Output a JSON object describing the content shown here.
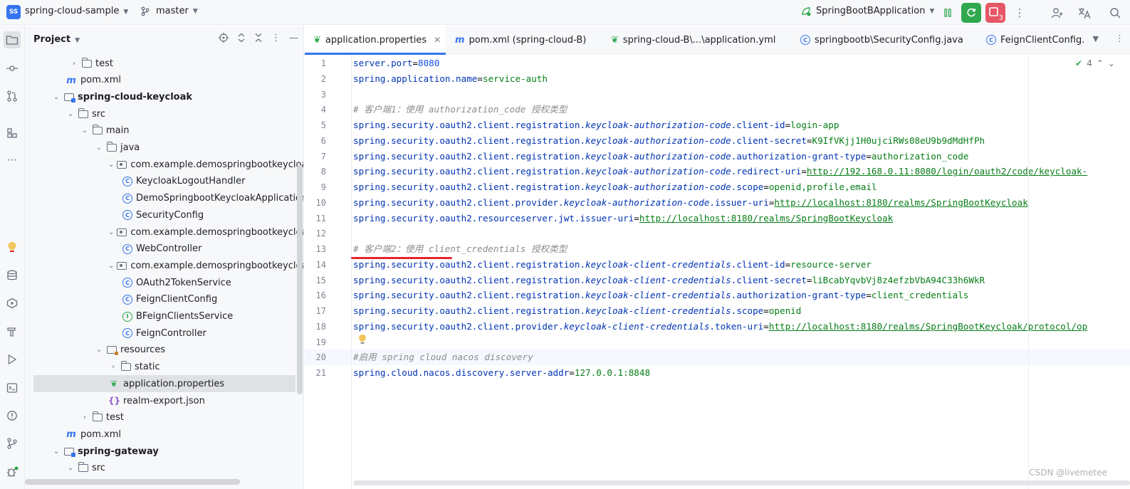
{
  "topbar": {
    "project_badge": "SS",
    "project_name": "spring-cloud-sample",
    "branch": "master",
    "run_config": "SpringBootBApplication",
    "stop_badge": "3",
    "icons": [
      "pause-icon",
      "rerun-icon",
      "stop-icon",
      "more-icon",
      "add-user-icon",
      "translate-icon",
      "search-icon"
    ]
  },
  "toolstrip": {
    "icons": [
      "folder-icon",
      "commit-icon",
      "pull-request-icon",
      "structure-icon",
      "more-icon",
      "bulb-icon",
      "database-icon",
      "services-icon",
      "build-icon",
      "run-icon",
      "terminal-icon",
      "problems-icon",
      "git-icon",
      "debug-icon"
    ]
  },
  "project_panel": {
    "title": "Project",
    "tree": [
      {
        "label": "test",
        "icon": "folder",
        "arrow": "›",
        "bold": false
      },
      {
        "label": "pom.xml",
        "icon": "maven",
        "arrow": "",
        "bold": false
      },
      {
        "label": "spring-cloud-keycloak",
        "icon": "module",
        "arrow": "⌄",
        "bold": true
      },
      {
        "label": "src",
        "icon": "folder",
        "arrow": "⌄",
        "bold": false
      },
      {
        "label": "main",
        "icon": "folder",
        "arrow": "⌄",
        "bold": false
      },
      {
        "label": "java",
        "icon": "folder",
        "arrow": "⌄",
        "bold": false
      },
      {
        "label": "com.example.demospringbootkeycloak",
        "icon": "package",
        "arrow": "⌄",
        "bold": false
      },
      {
        "label": "KeycloakLogoutHandler",
        "icon": "class",
        "arrow": "",
        "bold": false
      },
      {
        "label": "DemoSpringbootKeycloakApplication",
        "icon": "class",
        "arrow": "",
        "bold": false
      },
      {
        "label": "SecurityConfig",
        "icon": "class",
        "arrow": "",
        "bold": false
      },
      {
        "label": "com.example.demospringbootkeycloak.c",
        "icon": "package",
        "arrow": "⌄",
        "bold": false
      },
      {
        "label": "WebController",
        "icon": "class",
        "arrow": "",
        "bold": false
      },
      {
        "label": "com.example.demospringbootkeycloak.f",
        "icon": "package",
        "arrow": "⌄",
        "bold": false
      },
      {
        "label": "OAuth2TokenService",
        "icon": "class",
        "arrow": "",
        "bold": false
      },
      {
        "label": "FeignClientConfig",
        "icon": "class",
        "arrow": "",
        "bold": false
      },
      {
        "label": "BFeignClientsService",
        "icon": "interface",
        "arrow": "",
        "bold": false
      },
      {
        "label": "FeignController",
        "icon": "class",
        "arrow": "",
        "bold": false
      },
      {
        "label": "resources",
        "icon": "resources",
        "arrow": "⌄",
        "bold": false
      },
      {
        "label": "static",
        "icon": "folder",
        "arrow": "›",
        "bold": false
      },
      {
        "label": "application.properties",
        "icon": "properties",
        "arrow": "",
        "bold": false,
        "selected": true
      },
      {
        "label": "realm-export.json",
        "icon": "json",
        "arrow": "",
        "bold": false
      },
      {
        "label": "test",
        "icon": "folder",
        "arrow": "›",
        "bold": false
      },
      {
        "label": "pom.xml",
        "icon": "maven",
        "arrow": "",
        "bold": false
      },
      {
        "label": "spring-gateway",
        "icon": "module",
        "arrow": "⌄",
        "bold": true
      },
      {
        "label": "src",
        "icon": "folder",
        "arrow": "⌄",
        "bold": false
      }
    ]
  },
  "tabs": [
    {
      "label": "application.properties",
      "icon": "properties",
      "active": true
    },
    {
      "label": "pom.xml (spring-cloud-B)",
      "icon": "maven",
      "active": false
    },
    {
      "label": "spring-cloud-B\\...\\application.yml",
      "icon": "properties",
      "active": false
    },
    {
      "label": "springbootb\\SecurityConfig.java",
      "icon": "class",
      "active": false
    },
    {
      "label": "FeignClientConfig.",
      "icon": "class",
      "active": false
    }
  ],
  "editor": {
    "inspection_count": "4",
    "current_line": 20,
    "lines": [
      {
        "n": "1",
        "parts": [
          [
            "key",
            "server.port"
          ],
          [
            "eq",
            "="
          ],
          [
            "num",
            "8080"
          ]
        ]
      },
      {
        "n": "2",
        "parts": [
          [
            "key",
            "spring.application.name"
          ],
          [
            "eq",
            "="
          ],
          [
            "val",
            "service-auth"
          ]
        ]
      },
      {
        "n": "3",
        "parts": []
      },
      {
        "n": "4",
        "parts": [
          [
            "com",
            "# 客户端1：使用 authorization_code 授权类型"
          ]
        ]
      },
      {
        "n": "5",
        "parts": [
          [
            "key",
            "spring.security.oauth2.client.registration."
          ],
          [
            "it",
            "keycloak-authorization-code"
          ],
          [
            "key",
            ".client-id"
          ],
          [
            "eq",
            "="
          ],
          [
            "val",
            "login-app"
          ]
        ]
      },
      {
        "n": "6",
        "parts": [
          [
            "key",
            "spring.security.oauth2.client.registration."
          ],
          [
            "it",
            "keycloak-authorization-code"
          ],
          [
            "key",
            ".client-secret"
          ],
          [
            "eq",
            "="
          ],
          [
            "val",
            "K9IfVKjj1H0ujciRWs08eU9b9dMdHfPh"
          ]
        ]
      },
      {
        "n": "7",
        "parts": [
          [
            "key",
            "spring.security.oauth2.client.registration."
          ],
          [
            "it",
            "keycloak-authorization-code"
          ],
          [
            "key",
            ".authorization-grant-type"
          ],
          [
            "eq",
            "="
          ],
          [
            "val",
            "authorization_code"
          ]
        ]
      },
      {
        "n": "8",
        "parts": [
          [
            "key",
            "spring.security.oauth2.client.registration."
          ],
          [
            "it",
            "keycloak-authorization-code"
          ],
          [
            "key",
            ".redirect-uri"
          ],
          [
            "eq",
            "="
          ],
          [
            "url",
            "http://192.168.0.11:8080/login/oauth2/code/keycloak-"
          ]
        ]
      },
      {
        "n": "9",
        "parts": [
          [
            "key",
            "spring.security.oauth2.client.registration."
          ],
          [
            "it",
            "keycloak-authorization-code"
          ],
          [
            "key",
            ".scope"
          ],
          [
            "eq",
            "="
          ],
          [
            "val",
            "openid,profile,email"
          ]
        ]
      },
      {
        "n": "10",
        "parts": [
          [
            "key",
            "spring.security.oauth2.client.provider."
          ],
          [
            "it",
            "keycloak-authorization-code"
          ],
          [
            "key",
            ".issuer-uri"
          ],
          [
            "eq",
            "="
          ],
          [
            "url",
            "http://localhost:8180/realms/SpringBootKeycloak"
          ]
        ]
      },
      {
        "n": "11",
        "parts": [
          [
            "key",
            "spring.security.oauth2.resourceserver.jwt.issuer-uri"
          ],
          [
            "eq",
            "="
          ],
          [
            "url",
            "http://localhost:8180/realms/SpringBootKeycloak"
          ]
        ]
      },
      {
        "n": "12",
        "parts": []
      },
      {
        "n": "13",
        "parts": [
          [
            "com",
            "# 客户端2：使用 client_credentials 授权类型"
          ]
        ]
      },
      {
        "n": "14",
        "parts": [
          [
            "key",
            "spring.security.oauth2.client.registration."
          ],
          [
            "it",
            "keycloak-client-credentials"
          ],
          [
            "key",
            ".client-id"
          ],
          [
            "eq",
            "="
          ],
          [
            "val",
            "resource-server"
          ]
        ]
      },
      {
        "n": "15",
        "parts": [
          [
            "key",
            "spring.security.oauth2.client.registration."
          ],
          [
            "it",
            "keycloak-client-credentials"
          ],
          [
            "key",
            ".client-secret"
          ],
          [
            "eq",
            "="
          ],
          [
            "val",
            "liBcabYqvbVj8z4efzbVbA94C33h6WkR"
          ]
        ]
      },
      {
        "n": "16",
        "parts": [
          [
            "key",
            "spring.security.oauth2.client.registration."
          ],
          [
            "it",
            "keycloak-client-credentials"
          ],
          [
            "key",
            ".authorization-grant-type"
          ],
          [
            "eq",
            "="
          ],
          [
            "val",
            "client_credentials"
          ]
        ]
      },
      {
        "n": "17",
        "parts": [
          [
            "key",
            "spring.security.oauth2.client.registration."
          ],
          [
            "it",
            "keycloak-client-credentials"
          ],
          [
            "key",
            ".scope"
          ],
          [
            "eq",
            "="
          ],
          [
            "val",
            "openid"
          ]
        ]
      },
      {
        "n": "18",
        "parts": [
          [
            "key",
            "spring.security.oauth2.client.provider."
          ],
          [
            "it",
            "keycloak-client-credentials"
          ],
          [
            "key",
            ".token-uri"
          ],
          [
            "eq",
            "="
          ],
          [
            "url",
            "http://localhost:8180/realms/SpringBootKeycloak/protocol/op"
          ]
        ]
      },
      {
        "n": "19",
        "parts": []
      },
      {
        "n": "20",
        "parts": [
          [
            "com",
            "#启用 spring cloud nacos discovery"
          ]
        ]
      },
      {
        "n": "21",
        "parts": [
          [
            "key",
            "spring.cloud.nacos.discovery.server-addr"
          ],
          [
            "eq",
            "="
          ],
          [
            "val",
            "127.0.0.1:8848"
          ]
        ]
      }
    ]
  },
  "watermark": "CSDN @livemetee",
  "colors": {
    "accent": "#3574f0",
    "run_green": "#2fa84f",
    "stop_red": "#e55765",
    "annotation_red": "#e5262b",
    "key_blue": "#0033b3",
    "value_green": "#067d17",
    "comment_gray": "#8c8c8c"
  }
}
